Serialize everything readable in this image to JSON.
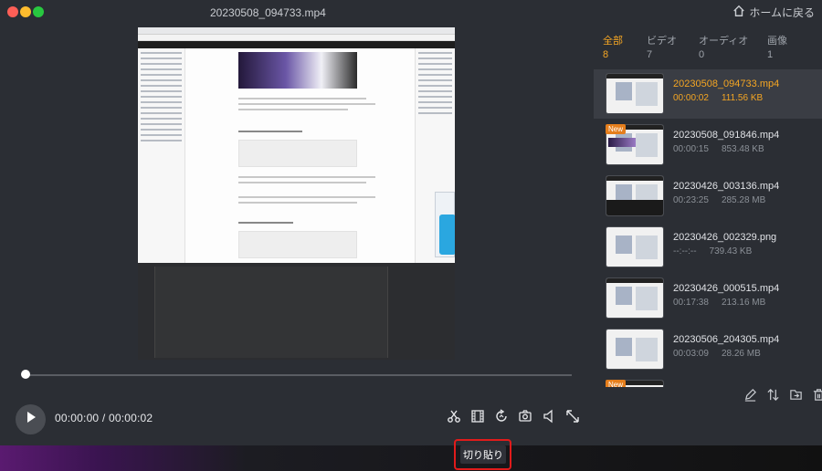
{
  "window": {
    "title": "20230508_094733.mp4",
    "home_label": "ホームに戻る"
  },
  "player": {
    "current_time": "00:00:00",
    "separator": "/",
    "total_time": "00:00:02",
    "progress_fraction": 0
  },
  "icons": {
    "play": "play-icon",
    "cut": "scissors-icon",
    "frames": "film-frames-icon",
    "rotate": "rotate-icon",
    "snapshot": "camera-icon",
    "speaker": "speaker-icon",
    "fullscreen": "expand-icon",
    "edit": "pencil-icon",
    "sort": "sort-arrows-icon",
    "export": "export-icon",
    "trash": "trash-icon",
    "home": "home-icon"
  },
  "categories": [
    {
      "label": "全部",
      "count": "8"
    },
    {
      "label": "ビデオ",
      "count": "7"
    },
    {
      "label": "オーディオ",
      "count": "0"
    },
    {
      "label": "画像",
      "count": "1"
    }
  ],
  "files": [
    {
      "name": "20230508_094733.mp4",
      "duration": "00:00:02",
      "size": "111.56 KB",
      "selected": true,
      "new": false
    },
    {
      "name": "20230508_091846.mp4",
      "duration": "00:00:15",
      "size": "853.48 KB",
      "selected": false,
      "new": true
    },
    {
      "name": "20230426_003136.mp4",
      "duration": "00:23:25",
      "size": "285.28 MB",
      "selected": false,
      "new": false
    },
    {
      "name": "20230426_002329.png",
      "duration": "--:--:--",
      "size": "739.43 KB",
      "selected": false,
      "new": false
    },
    {
      "name": "20230426_000515.mp4",
      "duration": "00:17:38",
      "size": "213.16 MB",
      "selected": false,
      "new": false
    },
    {
      "name": "20230506_204305.mp4",
      "duration": "00:03:09",
      "size": "28.26 MB",
      "selected": false,
      "new": false
    },
    {
      "name": "",
      "duration": "",
      "size": "",
      "selected": false,
      "new": true
    }
  ],
  "new_badge_label": "New",
  "bottom": {
    "cut_paste_label": "切り貼り"
  },
  "colors": {
    "accent": "#f5a623",
    "highlight_border": "#e11b1b",
    "background": "#2b2e34"
  }
}
